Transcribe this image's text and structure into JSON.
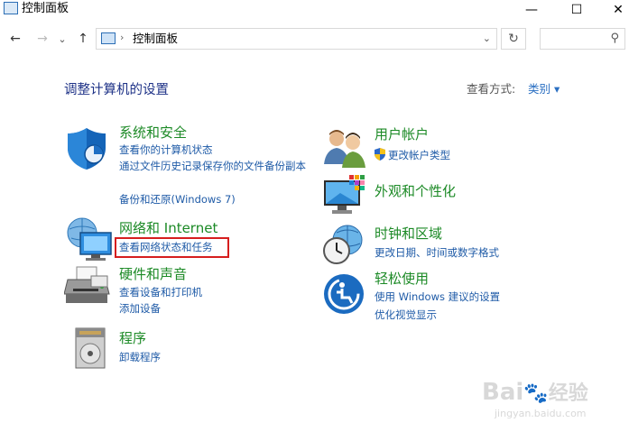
{
  "window": {
    "title": "控制面板",
    "minimize": "—",
    "maximize": "☐",
    "close": "✕"
  },
  "toolbar": {
    "back": "←",
    "forward": "→",
    "recent": "⌄",
    "up": "↑",
    "address_separator": "›",
    "address_text": "控制面板",
    "address_dropdown": "⌄",
    "refresh": "↻",
    "search_placeholder": "",
    "search_icon": "⚲"
  },
  "main": {
    "heading": "调整计算机的设置",
    "view_by_label": "查看方式:",
    "view_by_value": "类别 ▾"
  },
  "categories_left": [
    {
      "title": "系统和安全",
      "links": [
        "查看你的计算机状态",
        "通过文件历史记录保存你的文件备份副本",
        "备份和还原(Windows 7)"
      ],
      "icon": "shield-icon"
    },
    {
      "title": "网络和 Internet",
      "links": [
        "查看网络状态和任务"
      ],
      "icon": "network-icon"
    },
    {
      "title": "硬件和声音",
      "links": [
        "查看设备和打印机",
        "添加设备"
      ],
      "icon": "printer-icon"
    },
    {
      "title": "程序",
      "links": [
        "卸载程序"
      ],
      "icon": "programs-icon"
    }
  ],
  "categories_right": [
    {
      "title": "用户帐户",
      "links": [
        "更改帐户类型"
      ],
      "icon": "users-icon"
    },
    {
      "title": "外观和个性化",
      "links": [],
      "icon": "monitor-icon"
    },
    {
      "title": "时钟和区域",
      "links": [
        "更改日期、时间或数字格式"
      ],
      "icon": "clock-globe-icon"
    },
    {
      "title": "轻松使用",
      "links": [
        "使用 Windows 建议的设置",
        "优化视觉显示"
      ],
      "icon": "ease-of-access-icon"
    }
  ],
  "accent_colors": {
    "category": "#1c8a26",
    "link": "#1f5ba7",
    "heading": "#1e3287",
    "highlight": "#d61e1e"
  },
  "watermark": {
    "brand": "Bai",
    "brand2": "经验",
    "url": "jingyan.baidu.com"
  }
}
